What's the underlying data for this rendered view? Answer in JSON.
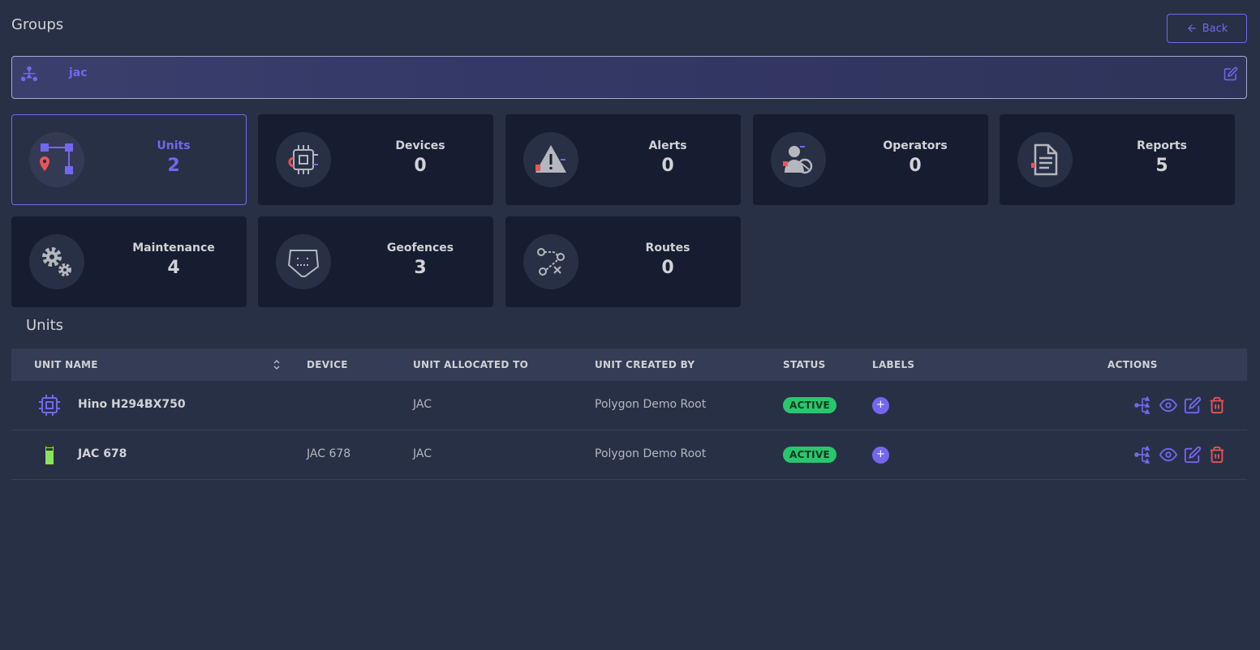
{
  "page": {
    "title": "Groups",
    "back_label": "Back"
  },
  "group": {
    "name": "jac"
  },
  "cards": [
    {
      "label": "Units",
      "value": "2",
      "icon": "units-icon"
    },
    {
      "label": "Devices",
      "value": "0",
      "icon": "chip-icon"
    },
    {
      "label": "Alerts",
      "value": "0",
      "icon": "alert-icon"
    },
    {
      "label": "Operators",
      "value": "0",
      "icon": "operator-icon"
    },
    {
      "label": "Reports",
      "value": "5",
      "icon": "report-icon"
    },
    {
      "label": "Maintenance",
      "value": "4",
      "icon": "gears-icon"
    },
    {
      "label": "Geofences",
      "value": "3",
      "icon": "geofence-icon"
    },
    {
      "label": "Routes",
      "value": "0",
      "icon": "route-icon"
    }
  ],
  "units_section": {
    "title": "Units"
  },
  "table": {
    "columns": {
      "unit_name": "UNIT NAME",
      "device": "DEVICE",
      "allocated_to": "UNIT ALLOCATED TO",
      "created_by": "UNIT CREATED BY",
      "status": "STATUS",
      "labels": "LABELS",
      "actions": "ACTIONS"
    },
    "rows": [
      {
        "unit_name": "Hino H294BX750",
        "device": "",
        "allocated_to": "JAC",
        "created_by": "Polygon Demo Root",
        "status": "ACTIVE",
        "label_add": "+"
      },
      {
        "unit_name": "JAC 678",
        "device": "JAC 678",
        "allocated_to": "JAC",
        "created_by": "Polygon Demo Root",
        "status": "ACTIVE",
        "label_add": "+"
      }
    ]
  },
  "colors": {
    "primary": "#7367f0",
    "success": "#28c76f",
    "danger": "#ea5455",
    "background": "#283046",
    "card": "#161d31"
  }
}
